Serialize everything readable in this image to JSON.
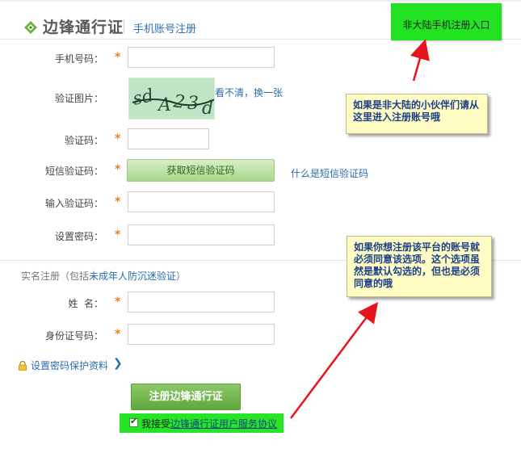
{
  "header": {
    "logo": "边锋通行证",
    "subtitle": "手机账号注册"
  },
  "overseas": {
    "label": "非大陆手机注册入口"
  },
  "notes": {
    "overseas": "如果是非大陆的小伙伴们请从这里进入注册账号哦",
    "agreement": "如果你想注册该平台的账号就必须同意该选项。这个选项虽然是默认勾选的，但也是必须同意的哦"
  },
  "form": {
    "phone_label": "手机号码：",
    "captcha_label": "验证图片：",
    "captcha_refresh": "看不清，换一张",
    "captcha_text": "sdA23d",
    "code_label": "验证码：",
    "sms_label": "短信验证码：",
    "sms_button": "获取短信验证码",
    "sms_help": "什么是短信验证码",
    "confirm_label": "输入验证码：",
    "password_label": "设置密码：",
    "required_mark": "*"
  },
  "realname": {
    "section_prefix": "实名注册（包括",
    "section_highlight": "未成年人防沉迷验证",
    "section_suffix": "）",
    "name_label": "姓  名：",
    "id_label": "身份证号码："
  },
  "security": {
    "link": "设置密码保护资料",
    "chevron": "❯"
  },
  "submit": {
    "label": "注册边锋通行证"
  },
  "agreement": {
    "checked": true,
    "check_glyph": "✔",
    "prefix": "我接受",
    "link": "边锋通行证用户服务协议"
  },
  "colors": {
    "star": "#f07d16",
    "link": "#2a6ca9",
    "highlight_green": "#22e322",
    "note_bg": "#fffdc3",
    "arrow": "#e8141b"
  }
}
